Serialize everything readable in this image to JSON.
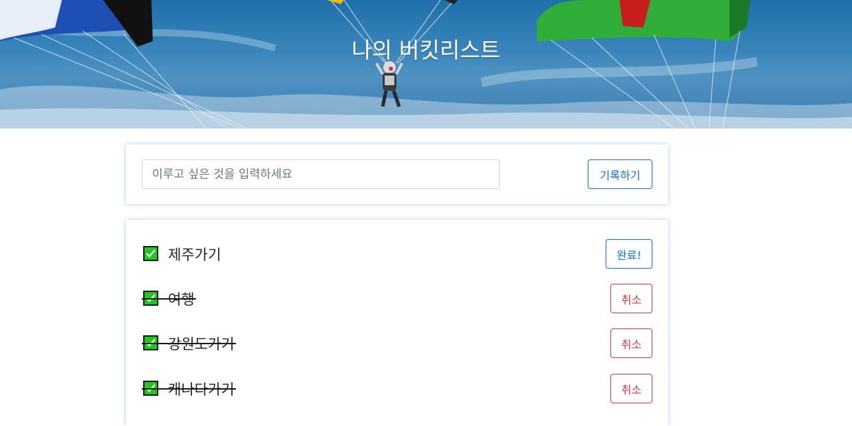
{
  "header": {
    "title": "나의 버킷리스트"
  },
  "form": {
    "placeholder": "이루고 싶은 것을 입력하세요",
    "value": "",
    "submit_label": "기록하기"
  },
  "list": {
    "items": [
      {
        "text": "제주가기",
        "done": false,
        "button_label": "완료!"
      },
      {
        "text": "여행",
        "done": true,
        "button_label": "취소"
      },
      {
        "text": "강원도가기",
        "done": true,
        "button_label": "취소"
      },
      {
        "text": "캐나다가기",
        "done": true,
        "button_label": "취소"
      }
    ]
  },
  "colors": {
    "primary": "#0d6efd",
    "danger": "#dc3545",
    "check_fill": "#22c81e"
  }
}
